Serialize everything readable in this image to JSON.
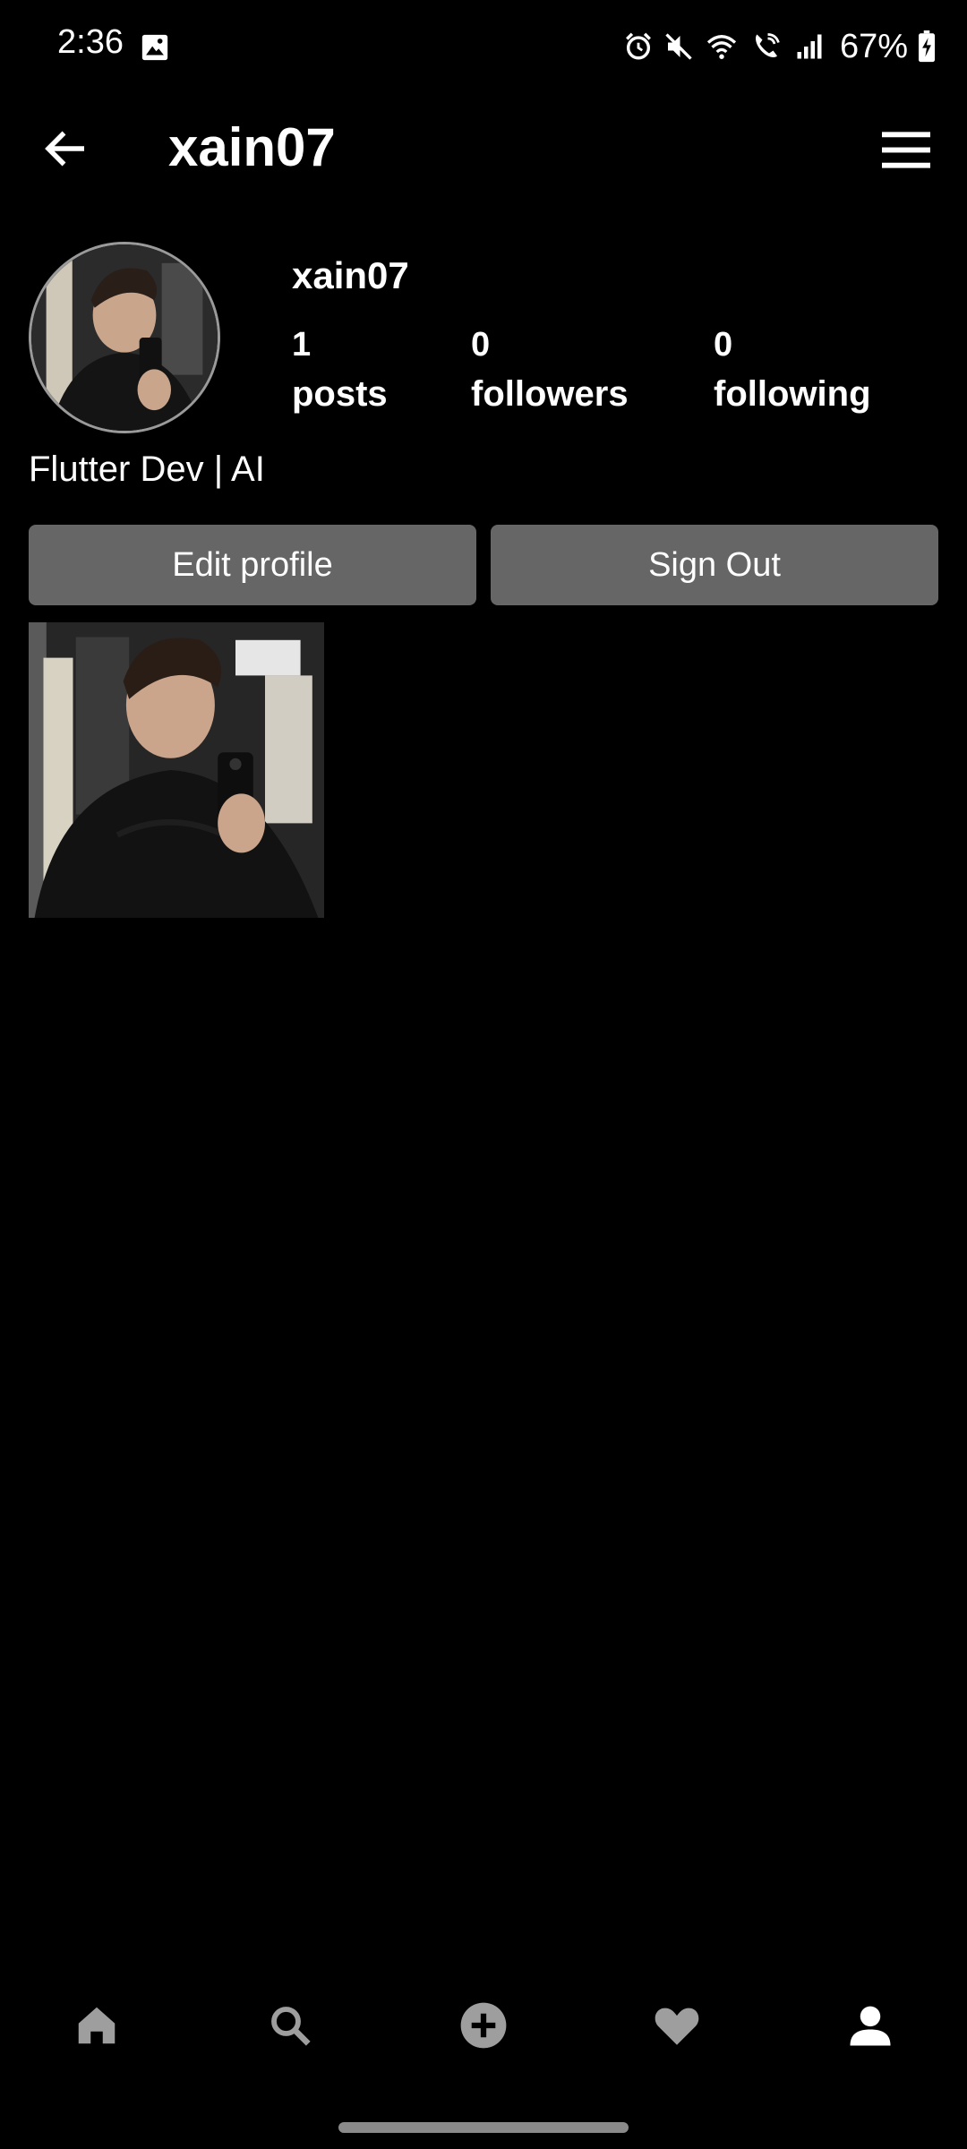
{
  "status_bar": {
    "time": "2:36",
    "battery": "67%",
    "icons": [
      "photo-icon",
      "alarm-icon",
      "mute-icon",
      "wifi-icon",
      "wifi-call-icon",
      "signal-icon",
      "battery-charging-icon"
    ]
  },
  "app_bar": {
    "title": "xain07",
    "back_icon": "arrow-back-icon",
    "menu_icon": "hamburger-menu-icon"
  },
  "profile": {
    "username": "xain07",
    "bio": "Flutter Dev | AI",
    "stats": [
      {
        "count": "1",
        "label": "posts"
      },
      {
        "count": "0",
        "label": "followers"
      },
      {
        "count": "0",
        "label": "following"
      }
    ],
    "buttons": {
      "edit_label": "Edit profile",
      "signout_label": "Sign Out"
    }
  },
  "posts": [
    {
      "type": "photo"
    }
  ],
  "bottom_nav": {
    "items": [
      "home-icon",
      "search-icon",
      "add-icon",
      "heart-icon",
      "profile-icon"
    ],
    "active": "profile-icon"
  },
  "colors": {
    "background": "#000000",
    "button": "#666666",
    "nav_icon": "#9e9e9e",
    "nav_active": "#ffffff"
  }
}
